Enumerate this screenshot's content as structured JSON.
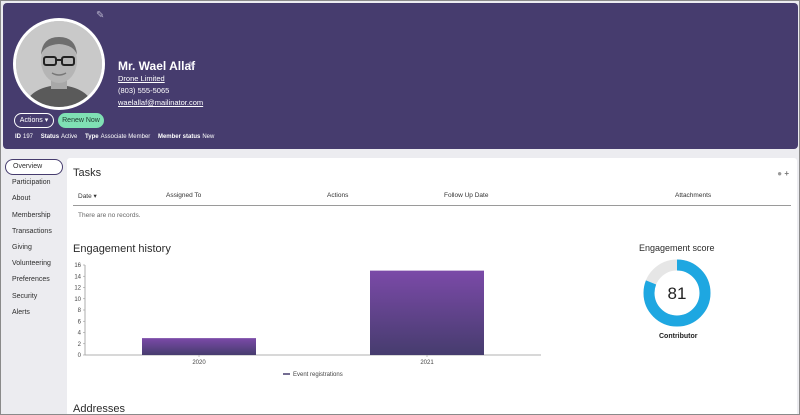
{
  "profile": {
    "name": "Mr. Wael Allaf",
    "company": "Drone Limited",
    "phone": "(803) 555-5065",
    "email": "waelallaf@mailinator.com",
    "actions_label": "Actions",
    "actions_caret": "▾",
    "renew_label": "Renew Now",
    "id_label": "ID",
    "id_value": "197",
    "status_label": "Status",
    "status_value": "Active",
    "type_label": "Type",
    "type_value": "Associate Member",
    "member_status_label": "Member status",
    "member_status_value": "New"
  },
  "sidebar": {
    "items": [
      {
        "label": "Overview"
      },
      {
        "label": "Participation"
      },
      {
        "label": "About"
      },
      {
        "label": "Membership"
      },
      {
        "label": "Transactions"
      },
      {
        "label": "Giving"
      },
      {
        "label": "Volunteering"
      },
      {
        "label": "Preferences"
      },
      {
        "label": "Security"
      },
      {
        "label": "Alerts"
      }
    ]
  },
  "tasks": {
    "title": "Tasks",
    "columns": [
      "Date ▾",
      "Assigned To",
      "Actions",
      "Follow Up Date",
      "Attachments"
    ],
    "empty_text": "There are no records."
  },
  "engagement": {
    "title": "Engagement history",
    "score_title": "Engagement score",
    "score_value": "81",
    "score_caption": "Contributor"
  },
  "addresses": {
    "title": "Addresses"
  },
  "colors": {
    "header_bg": "#463c6e",
    "bar_top": "#7b4aa8",
    "bar_bottom": "#463c6e",
    "gauge": "#1ea7e1",
    "gauge_track": "#e6e6e6",
    "renew_bg": "#7fe0b4"
  },
  "chart_data": {
    "type": "bar",
    "categories": [
      "2020",
      "2021"
    ],
    "series": [
      {
        "name": "Event registrations",
        "values": [
          3,
          15
        ]
      }
    ],
    "ylim": [
      0,
      16
    ],
    "yticks": [
      0,
      2,
      4,
      6,
      8,
      10,
      12,
      14,
      16
    ],
    "legend": "bottom",
    "grid": false
  }
}
